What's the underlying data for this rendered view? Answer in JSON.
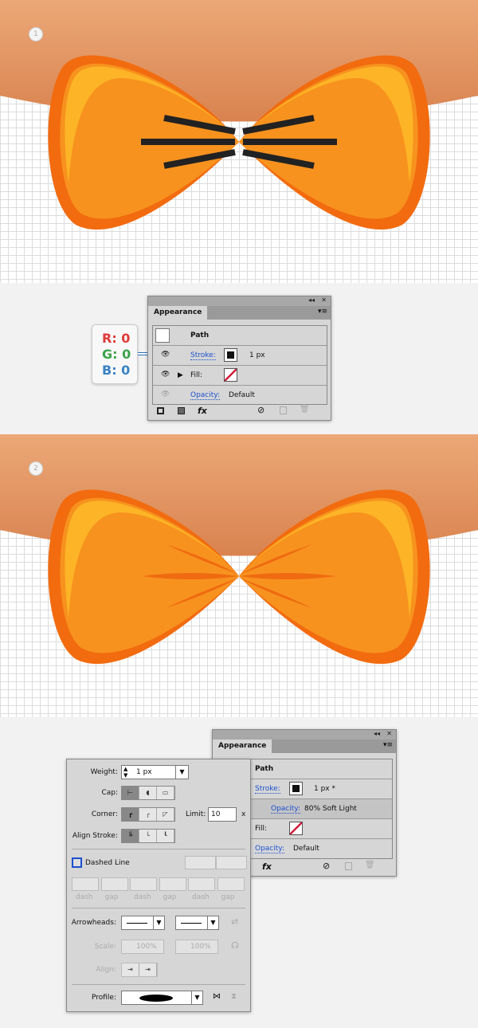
{
  "steps": [
    "1",
    "2"
  ],
  "colors": {
    "bow_fill": "#f7921e",
    "bow_outline": "#f26b0f",
    "bow_highlight": "#fdb827",
    "background_top": "#e39a66",
    "stripe_black": "#222222",
    "stripe_orange": "#ef6a10"
  },
  "rgb_callout": {
    "r": "R: 0",
    "g": "G: 0",
    "b": "B: 0"
  },
  "panel1": {
    "tab": "Appearance",
    "collapse_icon": "◂◂",
    "close_icon": "✕",
    "menu_icon": "▾≡",
    "path_label": "Path",
    "stroke_label": "Stroke:",
    "stroke_value": "1 px",
    "fill_label": "Fill:",
    "opacity_label": "Opacity:",
    "opacity_value": "Default",
    "fx_label": "fx"
  },
  "panel2": {
    "tab": "Appearance",
    "collapse_icon": "◂◂",
    "close_icon": "✕",
    "menu_icon": "▾≡",
    "path_label": "Path",
    "stroke_label": "Stroke:",
    "stroke_value": "1 px *",
    "sub_opacity_label": "Opacity:",
    "sub_opacity_value": "80% Soft Light",
    "fill_label": "Fill:",
    "opacity_label": "Opacity:",
    "opacity_value": "Default",
    "fx_label": "fx"
  },
  "stroke_panel": {
    "weight_label": "Weight:",
    "weight_value": "1 px",
    "cap_label": "Cap:",
    "corner_label": "Corner:",
    "limit_label": "Limit:",
    "limit_value": "10",
    "limit_unit": "x",
    "align_label": "Align Stroke:",
    "dashed_label": "Dashed Line",
    "dashed_checked": false,
    "dash_labels": [
      "dash",
      "gap",
      "dash",
      "gap",
      "dash",
      "gap"
    ],
    "arrowheads_label": "Arrowheads:",
    "scale_label": "Scale:",
    "scale_start": "100%",
    "scale_end": "100%",
    "align_arrow_label": "Align:",
    "profile_label": "Profile:"
  }
}
